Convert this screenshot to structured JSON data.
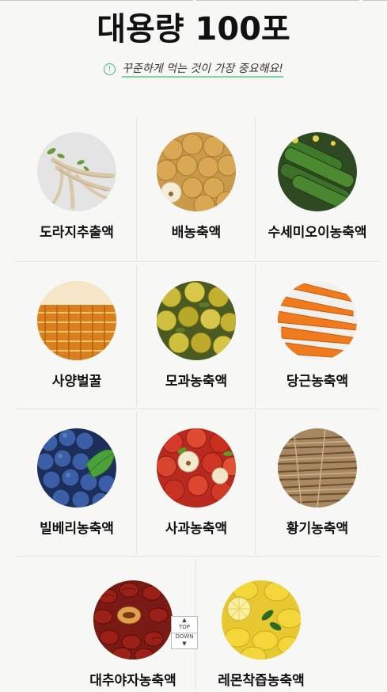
{
  "header": {
    "title": "대용량 100포",
    "subtitle": "꾸준하게 먹는 것이 가장 중요해요!"
  },
  "products": [
    {
      "label": "도라지추출액",
      "image": "doraji-root"
    },
    {
      "label": "배농축액",
      "image": "pears"
    },
    {
      "label": "수세미오이농축액",
      "image": "cucumbers"
    },
    {
      "label": "사양벌꿀",
      "image": "honeycomb"
    },
    {
      "label": "모과농축액",
      "image": "quince"
    },
    {
      "label": "당근농축액",
      "image": "carrots"
    },
    {
      "label": "빌베리농축액",
      "image": "bilberries"
    },
    {
      "label": "사과농축액",
      "image": "apples"
    },
    {
      "label": "황기농축액",
      "image": "astragalus-roots"
    },
    {
      "label": "대추야자농축액",
      "image": "jujubes"
    },
    {
      "label": "레몬착즙농축액",
      "image": "lemons"
    }
  ],
  "scroll_widget": {
    "up_arrow": "▲",
    "top_label": "TOP",
    "down_label": "DOWN",
    "down_arrow": "▼"
  },
  "colors": {
    "accent_green": "#3dbb78",
    "title": "#111111",
    "grid_line": "#dbe8e2"
  }
}
